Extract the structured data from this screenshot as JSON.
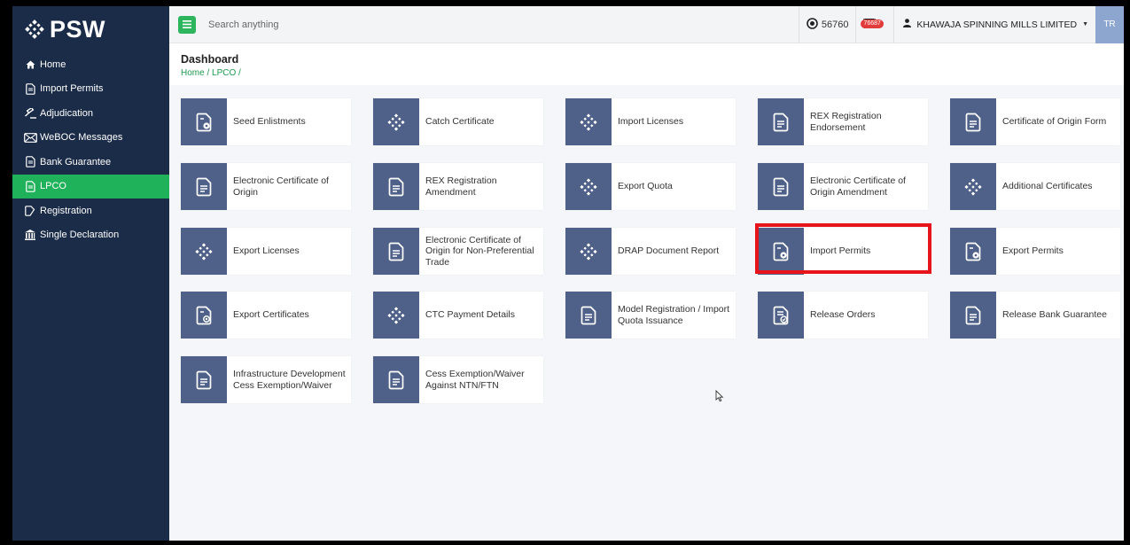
{
  "brand": {
    "logo_text": "PSW"
  },
  "sidebar": {
    "items": [
      {
        "label": "Home",
        "icon": "home-icon"
      },
      {
        "label": "Import Permits",
        "icon": "document-icon"
      },
      {
        "label": "Adjudication",
        "icon": "gavel-icon"
      },
      {
        "label": "WeBOC Messages",
        "icon": "envelope-icon"
      },
      {
        "label": "Bank Guarantee",
        "icon": "document-icon"
      },
      {
        "label": "LPCO",
        "icon": "document-icon",
        "active": true
      },
      {
        "label": "Registration",
        "icon": "pencil-icon"
      },
      {
        "label": "Single Declaration",
        "icon": "building-icon"
      }
    ]
  },
  "topbar": {
    "search_placeholder": "Search anything",
    "coins": "56760",
    "mail_badge": "76687",
    "user_name": "KHAWAJA SPINNING MILLS LIMITED",
    "initials": "TR"
  },
  "page": {
    "title": "Dashboard",
    "breadcrumb": "Home / LPCO /"
  },
  "cards": [
    {
      "label": "Seed Enlistments",
      "icon": "document-gear-icon"
    },
    {
      "label": "Catch Certificate",
      "icon": "psw-dots-icon"
    },
    {
      "label": "Import Licenses",
      "icon": "psw-dots-icon"
    },
    {
      "label": "REX Registration Endorsement",
      "icon": "document-lines-icon"
    },
    {
      "label": "Certificate of Origin Form",
      "icon": "document-lines-icon"
    },
    {
      "label": "Electronic Certificate of Origin",
      "icon": "document-lines-icon"
    },
    {
      "label": "REX Registration Amendment",
      "icon": "document-lines-icon"
    },
    {
      "label": "Export Quota",
      "icon": "psw-dots-icon"
    },
    {
      "label": "Electronic Certificate of Origin Amendment",
      "icon": "document-lines-icon"
    },
    {
      "label": "Additional Certificates",
      "icon": "psw-dots-icon"
    },
    {
      "label": "Export Licenses",
      "icon": "psw-dots-icon"
    },
    {
      "label": "Electronic Certificate of Origin for Non-Preferential Trade",
      "icon": "document-lines-icon"
    },
    {
      "label": "DRAP Document Report",
      "icon": "psw-dots-icon"
    },
    {
      "label": "Import Permits",
      "icon": "document-gear-icon"
    },
    {
      "label": "Export Permits",
      "icon": "document-gear-icon"
    },
    {
      "label": "Export Certificates",
      "icon": "document-badge-icon"
    },
    {
      "label": "CTC Payment Details",
      "icon": "psw-dots-icon"
    },
    {
      "label": "Model Registration / Import Quota Issuance",
      "icon": "document-lines-icon"
    },
    {
      "label": "Release Orders",
      "icon": "document-check-icon"
    },
    {
      "label": "Release Bank Guarantee",
      "icon": "document-lines-icon"
    },
    {
      "label": "Infrastructure Development Cess Exemption/Waiver",
      "icon": "document-lines-icon"
    },
    {
      "label": "Cess Exemption/Waiver Against NTN/FTN",
      "icon": "document-lines-icon"
    }
  ]
}
